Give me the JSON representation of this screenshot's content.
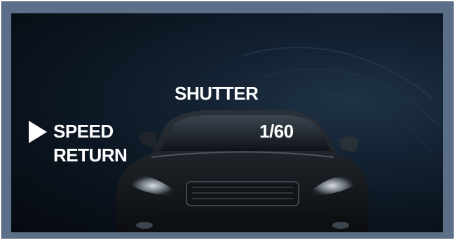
{
  "osd": {
    "title": "SHUTTER",
    "menu_items": [
      {
        "label": "SPEED",
        "value": "1/60",
        "selected": true
      },
      {
        "label": "RETURN",
        "value": "",
        "selected": false
      }
    ]
  },
  "colors": {
    "frame": "#5c6f88",
    "text": "#ffffff",
    "background": "#0a121c"
  },
  "icons": {
    "selection_cursor": "triangle-right-icon"
  }
}
